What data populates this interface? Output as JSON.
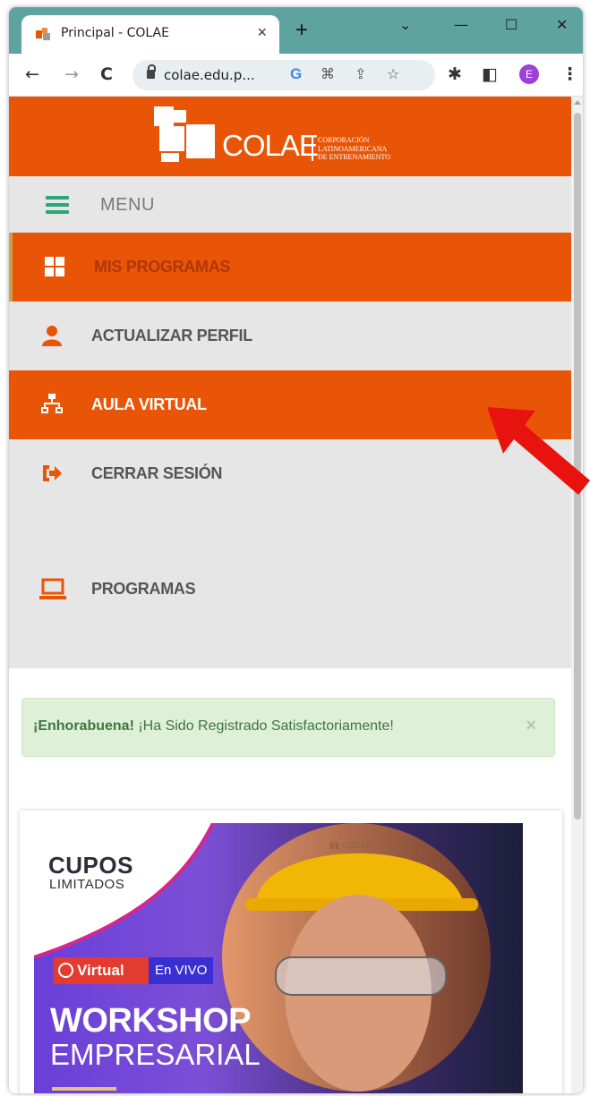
{
  "browser": {
    "tab_title": "Principal - COLAE",
    "tab_close": "×",
    "new_tab": "+",
    "window_controls": {
      "dropdown": "⌄",
      "minimize": "—",
      "maximize": "☐",
      "close": "✕"
    },
    "url": "colae.edu.p...",
    "avatar_letter": "E",
    "toolbar_icons": [
      "back-icon",
      "forward-icon",
      "reload-icon",
      "lock-icon",
      "google-icon",
      "translate-icon",
      "share-icon",
      "star-icon",
      "extensions-icon",
      "sidepanel-icon",
      "profile-avatar",
      "menu-kebab-icon"
    ]
  },
  "header": {
    "logo_word": "COLAE",
    "logo_sub_1": "CORPORACIÓN",
    "logo_sub_2": "LATINOAMERICANA",
    "logo_sub_3": "DE ENTRENAMIENTO"
  },
  "menu": {
    "title": "MENU",
    "items": [
      {
        "label": "MIS PROGRAMAS",
        "icon": "grid-icon",
        "active": true
      },
      {
        "label": "ACTUALIZAR PERFIL",
        "icon": "user-icon",
        "active": false
      },
      {
        "label": "AULA VIRTUAL",
        "icon": "sitemap-icon",
        "active": true
      },
      {
        "label": "CERRAR SESIÓN",
        "icon": "sign-out-icon",
        "active": false
      },
      {
        "label": "PROGRAMAS",
        "icon": "laptop-icon",
        "active": false
      }
    ]
  },
  "alert": {
    "strong": "¡Enhorabuena!",
    "text": " ¡Ha Sido Registrado Satisfactoriamente!",
    "close": "×"
  },
  "promo": {
    "line1": "CUPOS",
    "line2": "LIMITADOS",
    "badge_virtual": "Virtual",
    "badge_live": "En VIVO",
    "headline": "WORKSHOP",
    "subheadline": "EMPRESARIAL"
  },
  "colors": {
    "brand_orange": "#e95506",
    "menu_bg": "#e6e6e6",
    "alert_bg": "#dff0d8",
    "alert_text": "#3c763d",
    "annotation_arrow": "#e8130f",
    "browser_frame": "#5fa3a0"
  }
}
